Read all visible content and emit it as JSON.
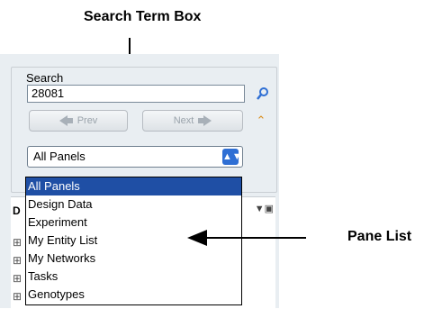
{
  "callouts": {
    "search_term_box": "Search Term Box",
    "pane_list": "Pane List"
  },
  "search": {
    "legend": "Search",
    "value": "28081",
    "prev_label": "Prev",
    "next_label": "Next"
  },
  "panel_select": {
    "selected": "All Panels",
    "options": [
      "All Panels",
      "Design Data",
      "Experiment",
      "My Entity List",
      "My Networks",
      "Tasks",
      "Genotypes"
    ]
  },
  "background_pane": {
    "header_letter": "D"
  },
  "colors": {
    "panel_bg": "#e9eef2",
    "selection": "#1f4fa5",
    "select_button": "#2f6fd4",
    "accent_icon": "#d98c1a"
  }
}
